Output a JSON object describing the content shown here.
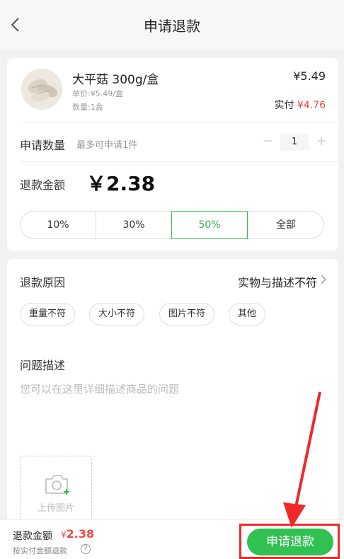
{
  "nav": {
    "title": "申请退款"
  },
  "product": {
    "name": "大平菇 300g/盒",
    "unit_price": "单价:¥5.49/盒",
    "quantity": "数量:1盒",
    "price": "¥5.49",
    "paid_label": "实付",
    "paid_amount": "¥4.76"
  },
  "apply_qty": {
    "label": "申请数量",
    "hint": "最多可申请1件",
    "minus": "−",
    "value": "1",
    "plus": "+"
  },
  "refund_amount": {
    "label": "退款金额",
    "value": "￥2.38"
  },
  "percent_options": [
    {
      "label": "10%"
    },
    {
      "label": "30%"
    },
    {
      "label": "50%"
    },
    {
      "label": "全部"
    }
  ],
  "reason": {
    "label": "退款原因",
    "value": "实物与描述不符",
    "tags": [
      {
        "label": "重量不符"
      },
      {
        "label": "大小不符"
      },
      {
        "label": "图片不符"
      },
      {
        "label": "其他"
      }
    ]
  },
  "description": {
    "label": "问题描述",
    "placeholder": "您可以在这里详细描述商品的问题"
  },
  "upload": {
    "label": "上传图片"
  },
  "bottom": {
    "amount_label": "退款金额",
    "currency": "¥",
    "amount": "2.38",
    "note": "按实付金额退款",
    "help": "?",
    "submit_label": "申请退款"
  },
  "colors": {
    "accent": "#30c152",
    "price_red": "#f04848",
    "highlight_red": "#f0282a"
  }
}
